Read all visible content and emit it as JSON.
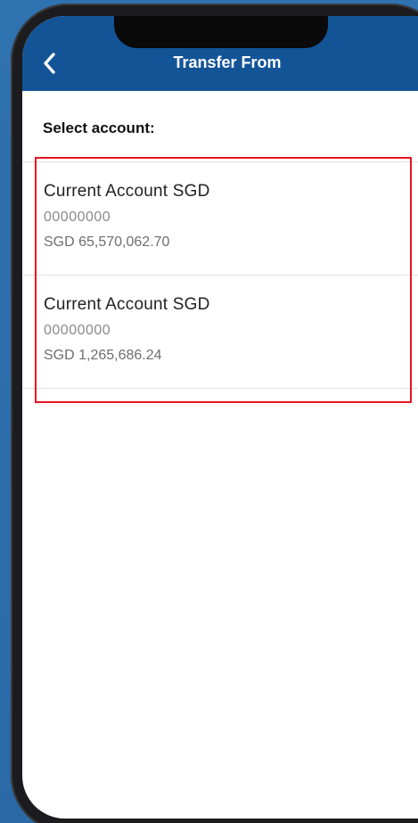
{
  "header": {
    "title": "Transfer From",
    "back_icon": "chevron-left-icon"
  },
  "section": {
    "label": "Select account:"
  },
  "accounts": [
    {
      "name": "Current Account SGD",
      "number": "00000000",
      "balance": "SGD 65,570,062.70"
    },
    {
      "name": "Current Account SGD",
      "number": "00000000",
      "balance": "SGD 1,265,686.24"
    }
  ],
  "colors": {
    "header_bg": "#135497",
    "background": "#2c6fae",
    "highlight": "#e8141e"
  }
}
